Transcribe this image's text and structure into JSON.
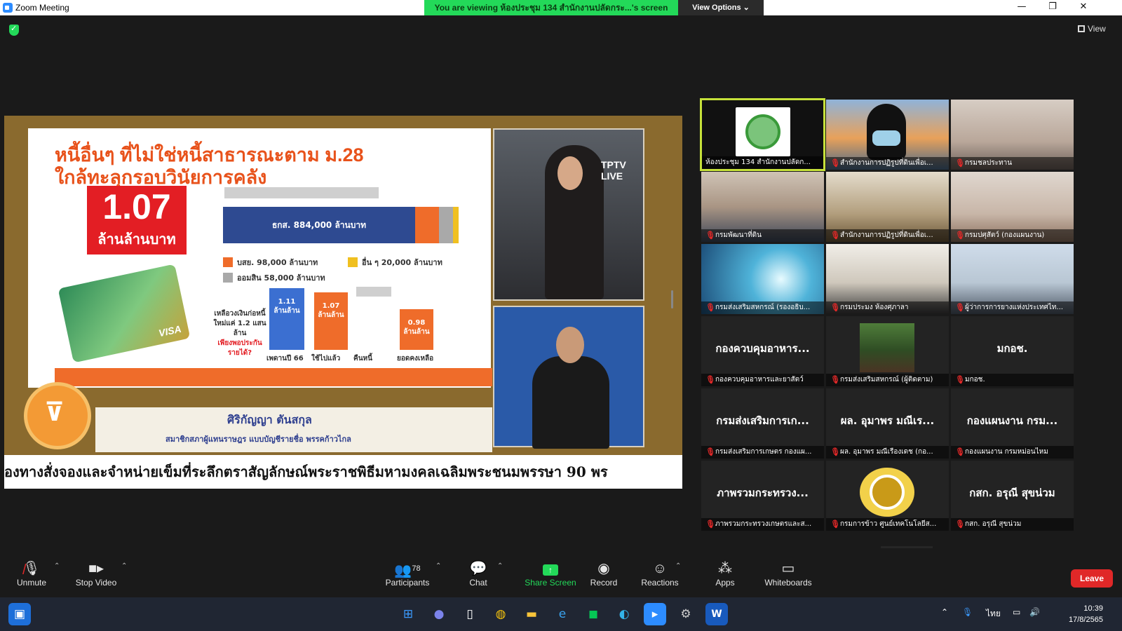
{
  "window": {
    "title": "Zoom Meeting",
    "viewing_banner": "You are viewing ห้องประชุม 134 สำนักงานปลัดกระ...'s screen",
    "view_options": "View Options ⌄",
    "controls": [
      "—",
      "❐",
      "✕"
    ]
  },
  "top_right": {
    "view_label": "View"
  },
  "slide": {
    "heading_line1": "หนี้อื่นๆ ที่ไม่ใช่หนี้สาธารณะตาม ม.28",
    "heading_line2": "ใกล้ทะลุกรอบวินัยการคลัง",
    "big_number": "1.07",
    "big_unit": "ล้านล้านบาท",
    "stack_label": "ธกส. 884,000 ล้านบาท",
    "legend": [
      {
        "label": "บสย. 98,000 ล้านบาท",
        "color": "#ef6c2a"
      },
      {
        "label": "อื่น ๆ 20,000 ล้านบาท",
        "color": "#f0c020"
      },
      {
        "label": "ออมสิน 58,000 ล้านบาท",
        "color": "#a9a9a9"
      }
    ],
    "bars": [
      {
        "value": "1.11",
        "unit": "ล้านล้าน",
        "label": "เพดานปี 66",
        "color": "#3b6fd1"
      },
      {
        "value": "1.07",
        "unit": "ล้านล้าน",
        "label": "ใช้ไปแล้ว",
        "color": "#ef6c2a"
      },
      {
        "value": "",
        "unit": "",
        "label": "คืนหนี้",
        "color": "#cfcfcf"
      },
      {
        "value": "0.98",
        "unit": "ล้านล้าน",
        "label": "ยอดคงเหลือ",
        "color": "#ef6c2a"
      }
    ],
    "remain_text": "เหลือวงเงินก่อหนี้ใหม่แค่ 1.2 แสนล้าน",
    "remain_question": "เพียงพอประกันรายได้?",
    "card_brand": "VISA",
    "speaker_name": "ศิริกัญญา ตันสกุล",
    "speaker_position": "สมาชิกสภาผู้แทนราษฎร แบบบัญชีรายชื่อ พรรคก้าวไกล",
    "party_small": "พรรคก้าวไกล",
    "tv_logo": "TPTV LIVE",
    "ticker": "องทางสั่งจองและจำหน่ายเข็มที่ระลึกตราสัญลักษณ์พระราชพิธีมหามงคลเฉลิมพระชนมพรรษา 90 พร"
  },
  "gallery": [
    {
      "label": "ห้องประชุม 134 สำนักงานปลัดก...",
      "big": "",
      "muted": false,
      "active": true,
      "kind": "seal"
    },
    {
      "label": "สำนักงานการปฏิรูปที่ดินเพื่อเ...",
      "big": "",
      "muted": true,
      "kind": "woman"
    },
    {
      "label": "กรมชลประทาน",
      "big": "",
      "muted": true,
      "kind": "room1"
    },
    {
      "label": "กรมพัฒนาที่ดิน",
      "big": "",
      "muted": true,
      "kind": "room2"
    },
    {
      "label": "สำนักงานการปฏิรูปที่ดินเพื่อเ...",
      "big": "",
      "muted": true,
      "kind": "room3"
    },
    {
      "label": "กรมปศุสัตว์ (กองแผนงาน)",
      "big": "",
      "muted": true,
      "kind": "room4"
    },
    {
      "label": "กรมส่งเสริมสหกรณ์ (รองอธิบ...",
      "big": "",
      "muted": true,
      "kind": "tunnel"
    },
    {
      "label": "กรมประมง ห้องศุภาลา",
      "big": "",
      "muted": true,
      "kind": "room5"
    },
    {
      "label": "ผู้ว่าการการยางแห่งประเทศไท...",
      "big": "",
      "muted": true,
      "kind": "room6"
    },
    {
      "label": "กองควบคุมอาหารและยาสัตว์",
      "big": "กองควบคุมอาหาร...",
      "muted": true,
      "kind": "name"
    },
    {
      "label": "กรมส่งเสริมสหกรณ์ (ผู้ติดตาม)",
      "big": "",
      "muted": true,
      "kind": "plant"
    },
    {
      "label": "มกอช.",
      "big": "มกอช.",
      "muted": true,
      "kind": "name"
    },
    {
      "label": "กรมส่งเสริมการเกษตร กองแผ...",
      "big": "กรมส่งเสริมการเก...",
      "muted": true,
      "kind": "name"
    },
    {
      "label": "ผล. อุมาพร มณีเรืองเดช (กอ...",
      "big": "ผล. อุมาพร มณีเร...",
      "muted": true,
      "kind": "name"
    },
    {
      "label": "กองแผนงาน กรมหม่อนไหม",
      "big": "กองแผนงาน กรม...",
      "muted": true,
      "kind": "name"
    },
    {
      "label": "ภาพรวมกระทรวงเกษตรและส...",
      "big": "ภาพรวมกระทรวง...",
      "muted": true,
      "kind": "name"
    },
    {
      "label": "กรมการข้าว ศูนย์เทคโนโลยีส...",
      "big": "",
      "muted": true,
      "kind": "rice"
    },
    {
      "label": "กสก. อรุณี สุขน่วม",
      "big": "กสก. อรุณี สุขน่วม",
      "muted": true,
      "kind": "name"
    }
  ],
  "toolbar": {
    "unmute": "Unmute",
    "stop_video": "Stop Video",
    "participants": "Participants",
    "participants_count": "78",
    "chat": "Chat",
    "share_screen": "Share Screen",
    "record": "Record",
    "reactions": "Reactions",
    "apps": "Apps",
    "whiteboards": "Whiteboards",
    "leave": "Leave"
  },
  "taskbar": {
    "language": "ไทย",
    "time": "10:39",
    "date": "17/8/2565"
  },
  "colors": {
    "accent_green": "#23d959",
    "leave_red": "#e02828",
    "active_border": "#c6e13a"
  }
}
